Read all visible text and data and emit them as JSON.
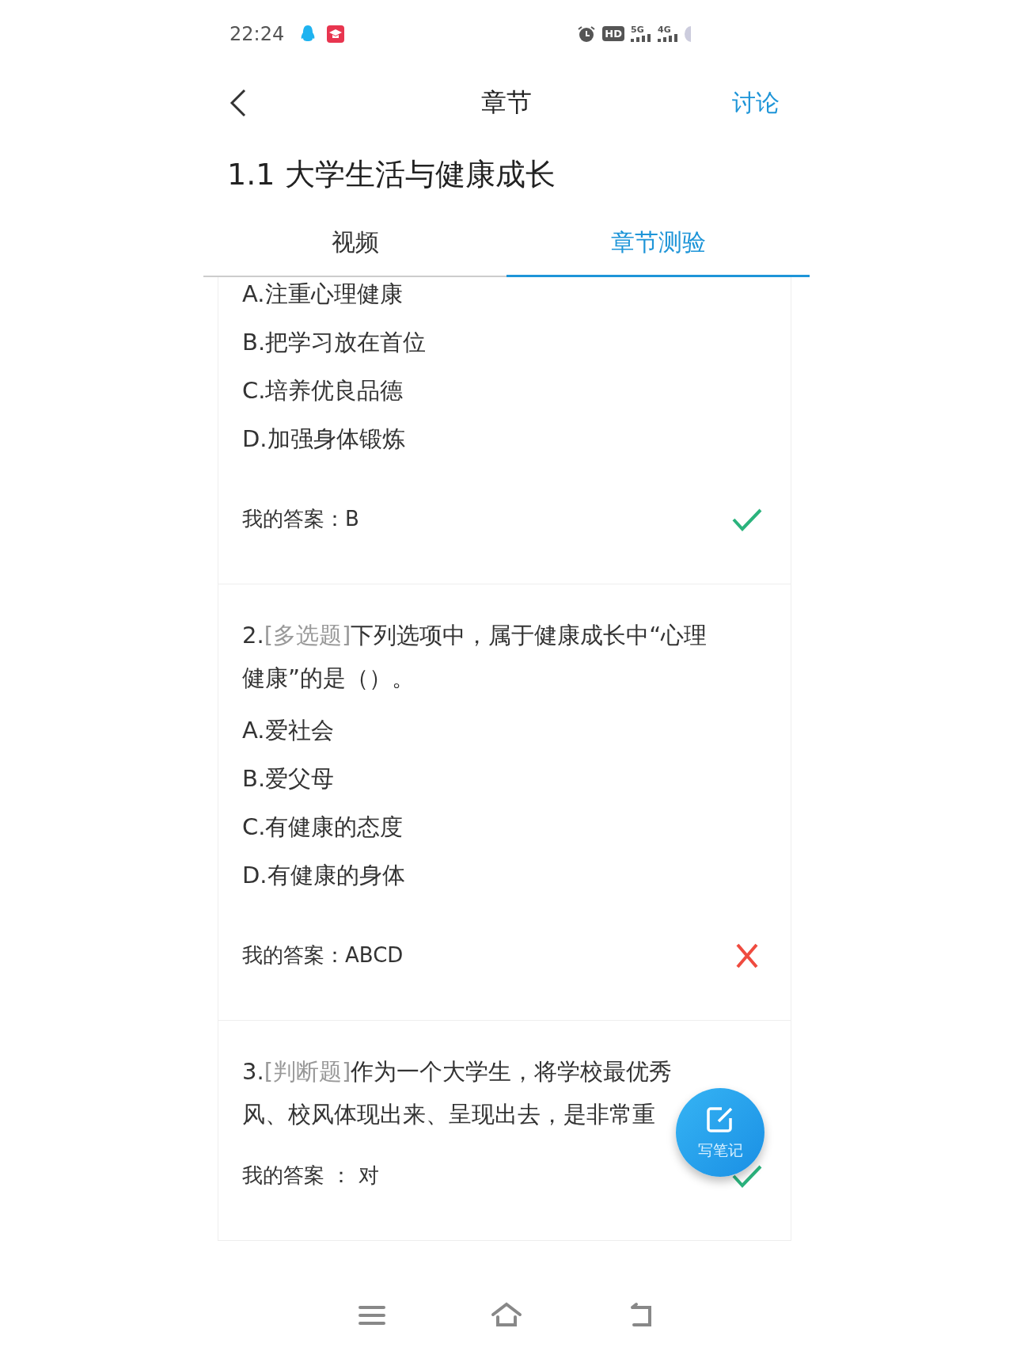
{
  "status_bar": {
    "time": "22:24",
    "hd_label": "HD",
    "network_labels": [
      "5G",
      "4G"
    ]
  },
  "header": {
    "title": "章节",
    "action": "讨论"
  },
  "chapter_title": "1.1 大学生活与健康成长",
  "tabs": [
    {
      "label": "视频",
      "selected": false
    },
    {
      "label": "章节测验",
      "selected": true
    }
  ],
  "questions": [
    {
      "options": [
        "A.注重心理健康",
        "B.把学习放在首位",
        "C.培养优良品德",
        "D.加强身体锻炼"
      ],
      "answer": "我的答案：B",
      "correct": true
    },
    {
      "number": "2.",
      "type": "[多选题]",
      "lines": [
        "下列选项中，属于健康成长中“心理",
        "健康”的是（）。"
      ],
      "options": [
        "A.爱社会",
        "B.爱父母",
        "C.有健康的态度",
        "D.有健康的身体"
      ],
      "answer": "我的答案：ABCD",
      "correct": false
    },
    {
      "number": "3.",
      "type": "[判断题]",
      "lines": [
        "作为一个大学生，将学校最优秀",
        "风、校风体现出来、呈现出去，是非常重"
      ],
      "answer": "我的答案 ： 对",
      "correct": true
    }
  ],
  "fab": {
    "label": "写笔记"
  }
}
